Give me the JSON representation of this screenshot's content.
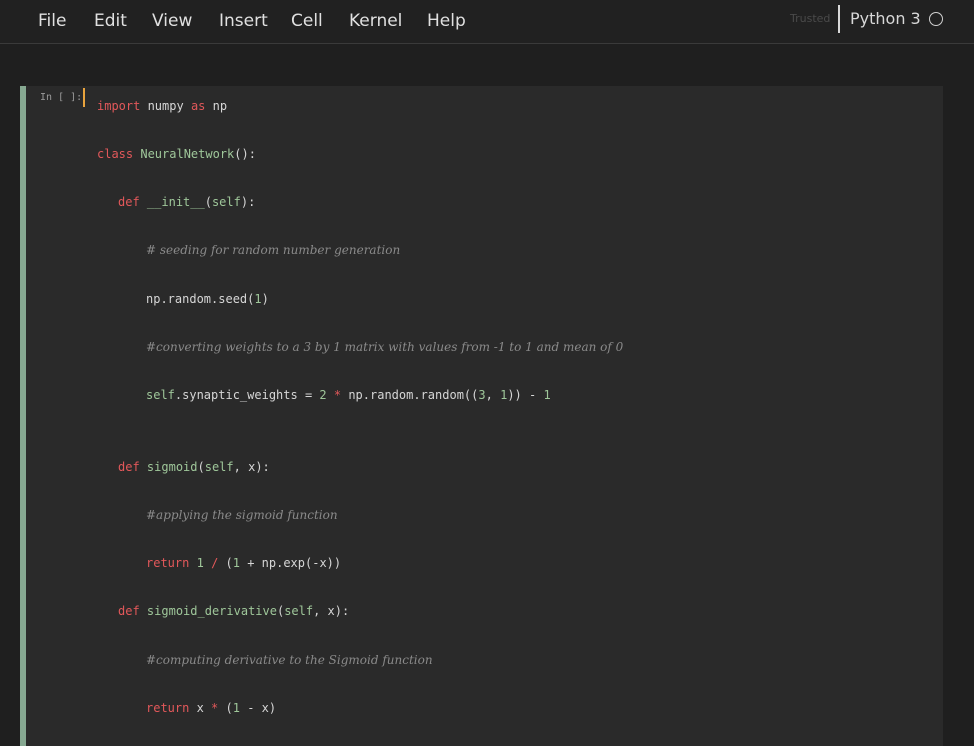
{
  "menubar": {
    "items": [
      "File",
      "Edit",
      "View",
      "Insert",
      "Cell",
      "Kernel",
      "Help"
    ]
  },
  "kernel": {
    "trusted": "Trusted",
    "name": "Python 3",
    "indicator": "kernel-idle-circle-icon"
  },
  "cell": {
    "prompt": "In [ ]:",
    "lines": [
      "import numpy as np",
      "class NeuralNetwork():",
      "def __init__(self):",
      "# seeding for random number generation",
      "np.random.seed(1)",
      "#converting weights to a 3 by 1 matrix with values from -1 to 1 and mean of 0",
      "self.synaptic_weights = 2 * np.random.random((3, 1)) - 1",
      "def sigmoid(self, x):",
      "#applying the sigmoid function",
      "return 1 / (1 + np.exp(-x))",
      "def sigmoid_derivative(self, x):",
      "#computing derivative to the Sigmoid function",
      "return x * (1 - x)"
    ]
  },
  "colors": {
    "keyword": "#e2585a",
    "name": "#9fc79a",
    "comment": "#8a8a8a",
    "cell_bar": "#86a891",
    "cursor": "#e8a33d"
  }
}
